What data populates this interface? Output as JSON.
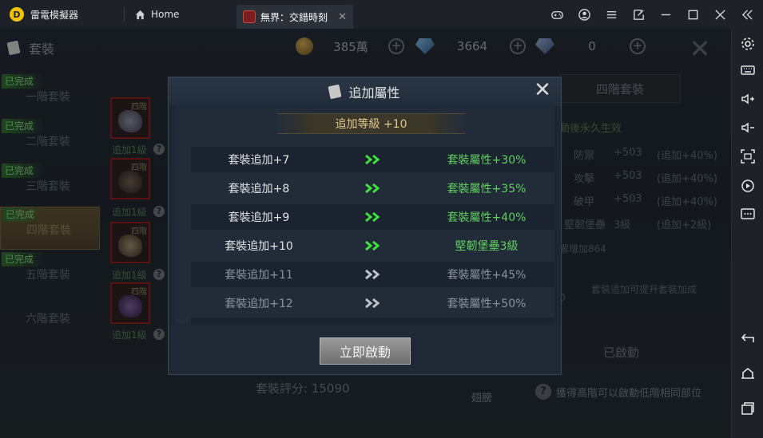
{
  "emulator": {
    "app_name": "雷電模擬器",
    "home_tab": "Home",
    "game_tab": "無界：交錯時刻",
    "tab_close": "✕"
  },
  "resources": [
    {
      "icon": "coin-icon",
      "value": "385萬"
    },
    {
      "icon": "blue-gem-icon",
      "value": "3664"
    },
    {
      "icon": "diamond-icon",
      "value": "0"
    }
  ],
  "left_panel": {
    "title": "套裝",
    "done_label": "已完成",
    "tiers": [
      "一階套裝",
      "二階套裝",
      "三階套裝",
      "四階套裝",
      "五階套裝",
      "六階套裝"
    ],
    "piece_tag": "四階",
    "piece_sub": "追加1級"
  },
  "right_panel": {
    "title": "四階套裝",
    "note": "動後永久生效",
    "stats": [
      {
        "name": "防禦",
        "value": "+503",
        "bonus": "(追加+40%)"
      },
      {
        "name": "攻擊",
        "value": "+503",
        "bonus": "(追加+40%)"
      },
      {
        "name": "破甲",
        "value": "+503",
        "bonus": "(追加+40%)"
      },
      {
        "name": "堅韌堡壘",
        "value": "3級",
        "bonus": "(追加+2級)"
      }
    ],
    "extra": "禦增加864",
    "hint_side": "套裝追加可提升套裝加成",
    "hint_zero": "0",
    "activated": "已啟動"
  },
  "bottom": {
    "score_label": "套裝評分:",
    "score_value": "15090",
    "wing_label": "翅膀",
    "hint": "獲得高階可以啟動低階相同部位"
  },
  "modal": {
    "title": "追加屬性",
    "level": "追加等級 +10",
    "rows": [
      {
        "left": "套裝追加+7",
        "right": "套裝屬性+30%",
        "active": true
      },
      {
        "left": "套裝追加+8",
        "right": "套裝屬性+35%",
        "active": true
      },
      {
        "left": "套裝追加+9",
        "right": "套裝屬性+40%",
        "active": true
      },
      {
        "left": "套裝追加+10",
        "right": "堅韌堡壘3級",
        "active": true
      },
      {
        "left": "套裝追加+11",
        "right": "套裝屬性+45%",
        "active": false
      },
      {
        "left": "套裝追加+12",
        "right": "套裝屬性+50%",
        "active": false
      }
    ],
    "button": "立即啟動",
    "close": "✕"
  },
  "colors": {
    "active_green": "#5fd15f",
    "gold_text": "#e2c98e",
    "arrow_active": "#3ee03e",
    "arrow_inactive": "#bfc3c8"
  }
}
